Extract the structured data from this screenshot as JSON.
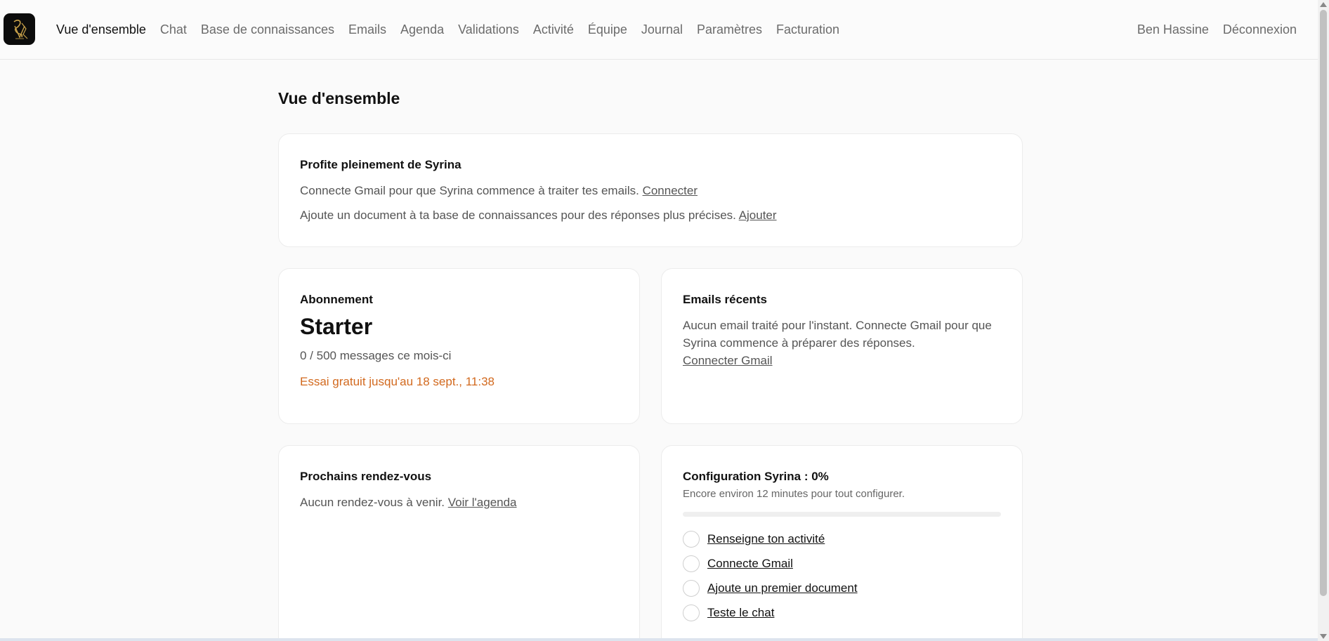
{
  "nav": {
    "items": [
      {
        "label": "Vue d'ensemble",
        "active": true
      },
      {
        "label": "Chat"
      },
      {
        "label": "Base de connaissances"
      },
      {
        "label": "Emails"
      },
      {
        "label": "Agenda"
      },
      {
        "label": "Validations"
      },
      {
        "label": "Activité"
      },
      {
        "label": "Équipe"
      },
      {
        "label": "Journal"
      },
      {
        "label": "Paramètres"
      },
      {
        "label": "Facturation"
      }
    ],
    "user": "Ben Hassine",
    "logout": "Déconnexion"
  },
  "page": {
    "title": "Vue d'ensemble"
  },
  "promo": {
    "title": "Profite pleinement de Syrina",
    "line1": "Connecte Gmail pour que Syrina commence à traiter tes emails.",
    "line1_link": "Connecter",
    "line2": "Ajoute un document à ta base de connaissances pour des réponses plus précises.",
    "line2_link": "Ajouter"
  },
  "subscription": {
    "title": "Abonnement",
    "plan": "Starter",
    "usage": "0 / 500 messages ce mois-ci",
    "trial": "Essai gratuit jusqu'au 18 sept., 11:38"
  },
  "emails": {
    "title": "Emails récents",
    "empty": "Aucun email traité pour l'instant. Connecte Gmail pour que Syrina commence à préparer des réponses.",
    "link": "Connecter Gmail"
  },
  "appointments": {
    "title": "Prochains rendez-vous",
    "empty": "Aucun rendez-vous à venir.",
    "link": "Voir l'agenda"
  },
  "config": {
    "title": "Configuration Syrina : 0%",
    "note": "Encore environ 12 minutes pour tout configurer.",
    "progress": 0,
    "steps": [
      {
        "label": "Renseigne ton activité"
      },
      {
        "label": "Connecte Gmail"
      },
      {
        "label": "Ajoute un premier document"
      },
      {
        "label": "Teste le chat"
      }
    ]
  },
  "colors": {
    "trial": "#d2691e",
    "logo_bg": "#0c0c0c",
    "logo_gold": "#c9a24a"
  }
}
